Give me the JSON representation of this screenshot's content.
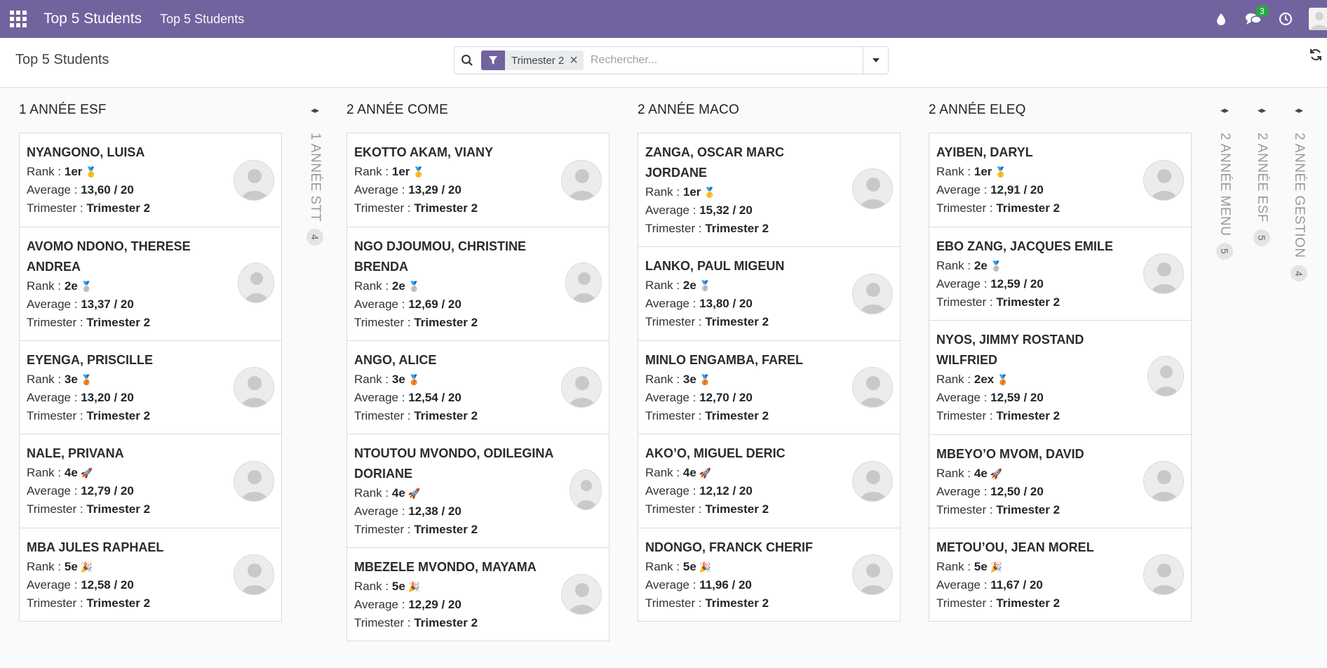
{
  "navbar": {
    "app_title": "Top 5 Students",
    "menu_item": "Top 5 Students",
    "messages_badge": "3",
    "accent_color": "#71639e"
  },
  "control_panel": {
    "breadcrumb": "Top 5 Students",
    "facet_value": "Trimester 2",
    "search_placeholder": "Rechercher..."
  },
  "labels": {
    "rank": "Rank : ",
    "average": "Average : ",
    "trimester": "Trimester : "
  },
  "columns": [
    {
      "title": "1 ANNÉE ESF",
      "cards": [
        {
          "name": "NYANGONO, LUISA",
          "rank": "1er",
          "medal": "🥇",
          "average": "13,60 / 20",
          "trimester": "Trimester 2"
        },
        {
          "name": "AVOMO NDONO, THERESE ANDREA",
          "rank": "2e",
          "medal": "🥈",
          "average": "13,37 / 20",
          "trimester": "Trimester 2"
        },
        {
          "name": "EYENGA, PRISCILLE",
          "rank": "3e",
          "medal": "🥉",
          "average": "13,20 / 20",
          "trimester": "Trimester 2"
        },
        {
          "name": "NALE, PRIVANA",
          "rank": "4e",
          "medal": "🚀",
          "average": "12,79 / 20",
          "trimester": "Trimester 2"
        },
        {
          "name": "MBA JULES RAPHAEL",
          "rank": "5e",
          "medal": "🎉",
          "average": "12,58 / 20",
          "trimester": "Trimester 2"
        }
      ]
    },
    {
      "title": "2 ANNÉE COME",
      "cards": [
        {
          "name": "EKOTTO AKAM, VIANY",
          "rank": "1er",
          "medal": "🥇",
          "average": "13,29 / 20",
          "trimester": "Trimester 2"
        },
        {
          "name": "NGO DJOUMOU, CHRISTINE BRENDA",
          "rank": "2e",
          "medal": "🥈",
          "average": "12,69 / 20",
          "trimester": "Trimester 2"
        },
        {
          "name": "ANGO, ALICE",
          "rank": "3e",
          "medal": "🥉",
          "average": "12,54 / 20",
          "trimester": "Trimester 2"
        },
        {
          "name": "NTOUTOU MVONDO, ODILEGINA DORIANE",
          "rank": "4e",
          "medal": "🚀",
          "average": "12,38 / 20",
          "trimester": "Trimester 2"
        },
        {
          "name": "MBEZELE MVONDO, MAYAMA",
          "rank": "5e",
          "medal": "🎉",
          "average": "12,29 / 20",
          "trimester": "Trimester 2"
        }
      ]
    },
    {
      "title": "2 ANNÉE MACO",
      "cards": [
        {
          "name": "ZANGA, OSCAR MARC JORDANE",
          "rank": "1er",
          "medal": "🥇",
          "average": "15,32 / 20",
          "trimester": "Trimester 2"
        },
        {
          "name": "LANKO, PAUL MIGEUN",
          "rank": "2e",
          "medal": "🥈",
          "average": "13,80 / 20",
          "trimester": "Trimester 2"
        },
        {
          "name": "MINLO ENGAMBA, FAREL",
          "rank": "3e",
          "medal": "🥉",
          "average": "12,70 / 20",
          "trimester": "Trimester 2"
        },
        {
          "name": "AKO’O, MIGUEL DERIC",
          "rank": "4e",
          "medal": "🚀",
          "average": "12,12 / 20",
          "trimester": "Trimester 2"
        },
        {
          "name": "NDONGO, FRANCK CHERIF",
          "rank": "5e",
          "medal": "🎉",
          "average": "11,96 / 20",
          "trimester": "Trimester 2"
        }
      ]
    },
    {
      "title": "2 ANNÉE ELEQ",
      "cards": [
        {
          "name": "AYIBEN, DARYL",
          "rank": "1er",
          "medal": "🥇",
          "average": "12,91 / 20",
          "trimester": "Trimester 2"
        },
        {
          "name": "EBO ZANG, JACQUES EMILE",
          "rank": "2e",
          "medal": "🥈",
          "average": "12,59 / 20",
          "trimester": "Trimester 2"
        },
        {
          "name": "NYOS, JIMMY ROSTAND WILFRIED",
          "rank": "2ex",
          "medal": "🥉",
          "average": "12,59 / 20",
          "trimester": "Trimester 2"
        },
        {
          "name": "MBEYO’O MVOM, DAVID",
          "rank": "4e",
          "medal": "🚀",
          "average": "12,50 / 20",
          "trimester": "Trimester 2"
        },
        {
          "name": "METOU’OU, JEAN MOREL",
          "rank": "5e",
          "medal": "🎉",
          "average": "11,67 / 20",
          "trimester": "Trimester 2"
        }
      ]
    }
  ],
  "folded_columns": [
    {
      "title": "1 ANNÉE STT",
      "count": "4"
    },
    {
      "title": "2 ANNÉE MENU",
      "count": "5"
    },
    {
      "title": "2 ANNÉE ESF",
      "count": "5"
    },
    {
      "title": "2 ANNÉE GESTION",
      "count": "4"
    }
  ]
}
